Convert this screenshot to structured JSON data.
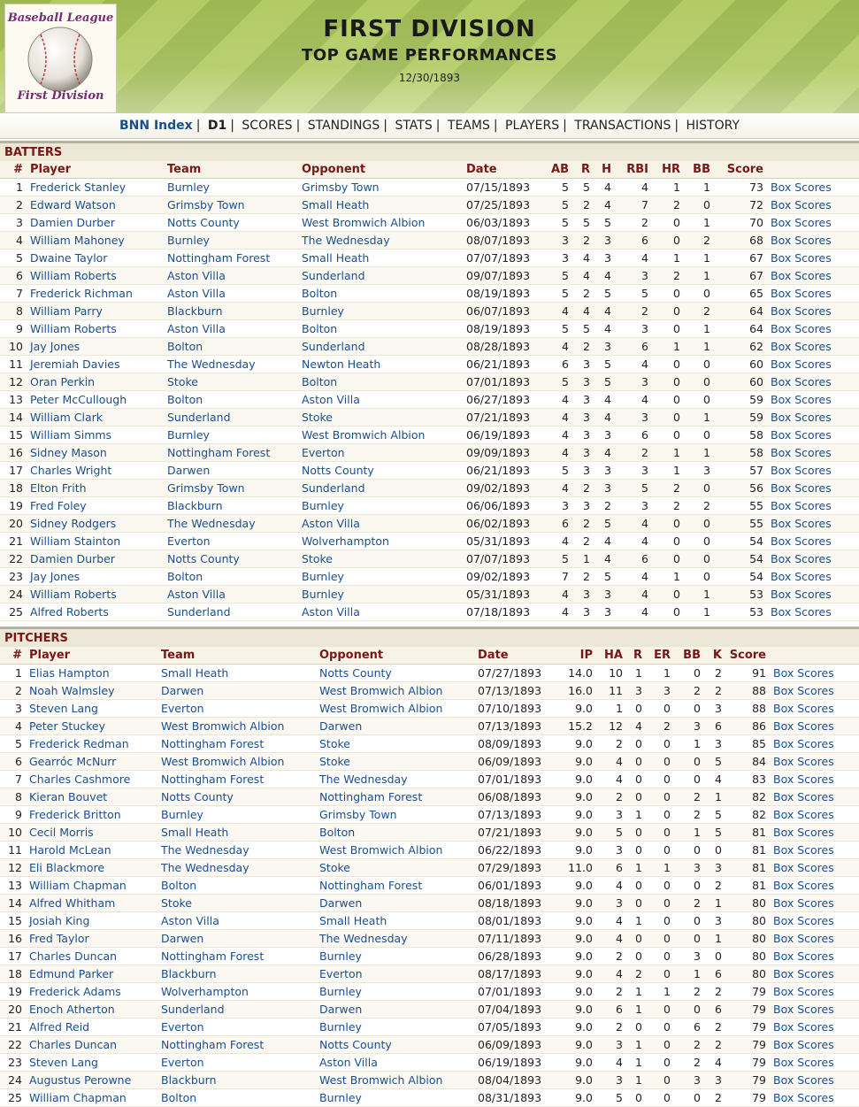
{
  "header": {
    "logo_top": "Baseball League",
    "logo_bottom": "First Division",
    "title": "FIRST DIVISION",
    "subtitle": "TOP GAME PERFORMANCES",
    "date": "12/30/1893"
  },
  "nav": [
    "BNN Index",
    "D1",
    "SCORES",
    "STANDINGS",
    "STATS",
    "TEAMS",
    "PLAYERS",
    "TRANSACTIONS",
    "HISTORY"
  ],
  "batters": {
    "title": "BATTERS",
    "columns": [
      "#",
      "Player",
      "Team",
      "Opponent",
      "Date",
      "AB",
      "R",
      "H",
      "RBI",
      "HR",
      "BB",
      "Score",
      ""
    ],
    "rows": [
      [
        "1",
        "Frederick Stanley",
        "Burnley",
        "Grimsby Town",
        "07/15/1893",
        "5",
        "5",
        "4",
        "4",
        "1",
        "1",
        "73",
        "Box Scores"
      ],
      [
        "2",
        "Edward Watson",
        "Grimsby Town",
        "Small Heath",
        "07/25/1893",
        "5",
        "2",
        "4",
        "7",
        "2",
        "0",
        "72",
        "Box Scores"
      ],
      [
        "3",
        "Damien Durber",
        "Notts County",
        "West Bromwich Albion",
        "06/03/1893",
        "5",
        "5",
        "5",
        "2",
        "0",
        "1",
        "70",
        "Box Scores"
      ],
      [
        "4",
        "William Mahoney",
        "Burnley",
        "The Wednesday",
        "08/07/1893",
        "3",
        "2",
        "3",
        "6",
        "0",
        "2",
        "68",
        "Box Scores"
      ],
      [
        "5",
        "Dwaine Taylor",
        "Nottingham Forest",
        "Small Heath",
        "07/07/1893",
        "3",
        "4",
        "3",
        "4",
        "1",
        "1",
        "67",
        "Box Scores"
      ],
      [
        "6",
        "William Roberts",
        "Aston Villa",
        "Sunderland",
        "09/07/1893",
        "5",
        "4",
        "4",
        "3",
        "2",
        "1",
        "67",
        "Box Scores"
      ],
      [
        "7",
        "Frederick Richman",
        "Aston Villa",
        "Bolton",
        "08/19/1893",
        "5",
        "2",
        "5",
        "5",
        "0",
        "0",
        "65",
        "Box Scores"
      ],
      [
        "8",
        "William Parry",
        "Blackburn",
        "Burnley",
        "06/07/1893",
        "4",
        "4",
        "4",
        "2",
        "0",
        "2",
        "64",
        "Box Scores"
      ],
      [
        "9",
        "William Roberts",
        "Aston Villa",
        "Bolton",
        "08/19/1893",
        "5",
        "5",
        "4",
        "3",
        "0",
        "1",
        "64",
        "Box Scores"
      ],
      [
        "10",
        "Jay Jones",
        "Bolton",
        "Sunderland",
        "08/28/1893",
        "4",
        "2",
        "3",
        "6",
        "1",
        "1",
        "62",
        "Box Scores"
      ],
      [
        "11",
        "Jeremiah Davies",
        "The Wednesday",
        "Newton Heath",
        "06/21/1893",
        "6",
        "3",
        "5",
        "4",
        "0",
        "0",
        "60",
        "Box Scores"
      ],
      [
        "12",
        "Oran Perkin",
        "Stoke",
        "Bolton",
        "07/01/1893",
        "5",
        "3",
        "5",
        "3",
        "0",
        "0",
        "60",
        "Box Scores"
      ],
      [
        "13",
        "Peter McCullough",
        "Bolton",
        "Aston Villa",
        "06/27/1893",
        "4",
        "3",
        "4",
        "4",
        "0",
        "0",
        "59",
        "Box Scores"
      ],
      [
        "14",
        "William Clark",
        "Sunderland",
        "Stoke",
        "07/21/1893",
        "4",
        "3",
        "4",
        "3",
        "0",
        "1",
        "59",
        "Box Scores"
      ],
      [
        "15",
        "William Simms",
        "Burnley",
        "West Bromwich Albion",
        "06/19/1893",
        "4",
        "3",
        "3",
        "6",
        "0",
        "0",
        "58",
        "Box Scores"
      ],
      [
        "16",
        "Sidney Mason",
        "Nottingham Forest",
        "Everton",
        "09/09/1893",
        "4",
        "3",
        "4",
        "2",
        "1",
        "1",
        "58",
        "Box Scores"
      ],
      [
        "17",
        "Charles Wright",
        "Darwen",
        "Notts County",
        "06/21/1893",
        "5",
        "3",
        "3",
        "3",
        "1",
        "3",
        "57",
        "Box Scores"
      ],
      [
        "18",
        "Elton Frith",
        "Grimsby Town",
        "Sunderland",
        "09/02/1893",
        "4",
        "2",
        "3",
        "5",
        "2",
        "0",
        "56",
        "Box Scores"
      ],
      [
        "19",
        "Fred Foley",
        "Blackburn",
        "Burnley",
        "06/06/1893",
        "3",
        "3",
        "2",
        "3",
        "2",
        "2",
        "55",
        "Box Scores"
      ],
      [
        "20",
        "Sidney Rodgers",
        "The Wednesday",
        "Aston Villa",
        "06/02/1893",
        "6",
        "2",
        "5",
        "4",
        "0",
        "0",
        "55",
        "Box Scores"
      ],
      [
        "21",
        "William Stainton",
        "Everton",
        "Wolverhampton",
        "05/31/1893",
        "4",
        "2",
        "4",
        "4",
        "0",
        "0",
        "54",
        "Box Scores"
      ],
      [
        "22",
        "Damien Durber",
        "Notts County",
        "Stoke",
        "07/07/1893",
        "5",
        "1",
        "4",
        "6",
        "0",
        "0",
        "54",
        "Box Scores"
      ],
      [
        "23",
        "Jay Jones",
        "Bolton",
        "Burnley",
        "09/02/1893",
        "7",
        "2",
        "5",
        "4",
        "1",
        "0",
        "54",
        "Box Scores"
      ],
      [
        "24",
        "William Roberts",
        "Aston Villa",
        "Burnley",
        "05/31/1893",
        "4",
        "3",
        "3",
        "4",
        "0",
        "1",
        "53",
        "Box Scores"
      ],
      [
        "25",
        "Alfred Roberts",
        "Sunderland",
        "Aston Villa",
        "07/18/1893",
        "4",
        "3",
        "3",
        "4",
        "0",
        "1",
        "53",
        "Box Scores"
      ]
    ]
  },
  "pitchers": {
    "title": "PITCHERS",
    "columns": [
      "#",
      "Player",
      "Team",
      "Opponent",
      "Date",
      "IP",
      "HA",
      "R",
      "ER",
      "BB",
      "K",
      "Score",
      ""
    ],
    "rows": [
      [
        "1",
        "Elias Hampton",
        "Small Heath",
        "Notts County",
        "07/27/1893",
        "14.0",
        "10",
        "1",
        "1",
        "0",
        "2",
        "91",
        "Box Scores"
      ],
      [
        "2",
        "Noah Walmsley",
        "Darwen",
        "West Bromwich Albion",
        "07/13/1893",
        "16.0",
        "11",
        "3",
        "3",
        "2",
        "2",
        "88",
        "Box Scores"
      ],
      [
        "3",
        "Steven Lang",
        "Everton",
        "West Bromwich Albion",
        "07/10/1893",
        "9.0",
        "1",
        "0",
        "0",
        "0",
        "3",
        "88",
        "Box Scores"
      ],
      [
        "4",
        "Peter Stuckey",
        "West Bromwich Albion",
        "Darwen",
        "07/13/1893",
        "15.2",
        "12",
        "4",
        "2",
        "3",
        "6",
        "86",
        "Box Scores"
      ],
      [
        "5",
        "Frederick Redman",
        "Nottingham Forest",
        "Stoke",
        "08/09/1893",
        "9.0",
        "2",
        "0",
        "0",
        "1",
        "3",
        "85",
        "Box Scores"
      ],
      [
        "6",
        "Gearróc McNurr",
        "West Bromwich Albion",
        "Stoke",
        "06/09/1893",
        "9.0",
        "4",
        "0",
        "0",
        "0",
        "5",
        "84",
        "Box Scores"
      ],
      [
        "7",
        "Charles Cashmore",
        "Nottingham Forest",
        "The Wednesday",
        "07/01/1893",
        "9.0",
        "4",
        "0",
        "0",
        "0",
        "4",
        "83",
        "Box Scores"
      ],
      [
        "8",
        "Kieran Bouvet",
        "Notts County",
        "Nottingham Forest",
        "06/08/1893",
        "9.0",
        "2",
        "0",
        "0",
        "2",
        "1",
        "82",
        "Box Scores"
      ],
      [
        "9",
        "Frederick Britton",
        "Burnley",
        "Grimsby Town",
        "07/13/1893",
        "9.0",
        "3",
        "1",
        "0",
        "2",
        "5",
        "82",
        "Box Scores"
      ],
      [
        "10",
        "Cecil Morris",
        "Small Heath",
        "Bolton",
        "07/21/1893",
        "9.0",
        "5",
        "0",
        "0",
        "1",
        "5",
        "81",
        "Box Scores"
      ],
      [
        "11",
        "Harold McLean",
        "The Wednesday",
        "West Bromwich Albion",
        "06/22/1893",
        "9.0",
        "3",
        "0",
        "0",
        "0",
        "0",
        "81",
        "Box Scores"
      ],
      [
        "12",
        "Eli Blackmore",
        "The Wednesday",
        "Stoke",
        "07/29/1893",
        "11.0",
        "6",
        "1",
        "1",
        "3",
        "3",
        "81",
        "Box Scores"
      ],
      [
        "13",
        "William Chapman",
        "Bolton",
        "Nottingham Forest",
        "06/01/1893",
        "9.0",
        "4",
        "0",
        "0",
        "0",
        "2",
        "81",
        "Box Scores"
      ],
      [
        "14",
        "Alfred Whitham",
        "Stoke",
        "Darwen",
        "08/18/1893",
        "9.0",
        "3",
        "0",
        "0",
        "2",
        "1",
        "80",
        "Box Scores"
      ],
      [
        "15",
        "Josiah King",
        "Aston Villa",
        "Small Heath",
        "08/01/1893",
        "9.0",
        "4",
        "1",
        "0",
        "0",
        "3",
        "80",
        "Box Scores"
      ],
      [
        "16",
        "Fred Taylor",
        "Darwen",
        "The Wednesday",
        "07/11/1893",
        "9.0",
        "4",
        "0",
        "0",
        "0",
        "1",
        "80",
        "Box Scores"
      ],
      [
        "17",
        "Charles Duncan",
        "Nottingham Forest",
        "Burnley",
        "06/28/1893",
        "9.0",
        "2",
        "0",
        "0",
        "3",
        "0",
        "80",
        "Box Scores"
      ],
      [
        "18",
        "Edmund Parker",
        "Blackburn",
        "Everton",
        "08/17/1893",
        "9.0",
        "4",
        "2",
        "0",
        "1",
        "6",
        "80",
        "Box Scores"
      ],
      [
        "19",
        "Frederick Adams",
        "Wolverhampton",
        "Burnley",
        "07/01/1893",
        "9.0",
        "2",
        "1",
        "1",
        "2",
        "2",
        "79",
        "Box Scores"
      ],
      [
        "20",
        "Enoch Atherton",
        "Sunderland",
        "Darwen",
        "07/04/1893",
        "9.0",
        "6",
        "1",
        "0",
        "0",
        "6",
        "79",
        "Box Scores"
      ],
      [
        "21",
        "Alfred Reid",
        "Everton",
        "Burnley",
        "07/05/1893",
        "9.0",
        "2",
        "0",
        "0",
        "6",
        "2",
        "79",
        "Box Scores"
      ],
      [
        "22",
        "Charles Duncan",
        "Nottingham Forest",
        "Notts County",
        "06/09/1893",
        "9.0",
        "3",
        "1",
        "0",
        "2",
        "2",
        "79",
        "Box Scores"
      ],
      [
        "23",
        "Steven Lang",
        "Everton",
        "Aston Villa",
        "06/19/1893",
        "9.0",
        "4",
        "1",
        "0",
        "2",
        "4",
        "79",
        "Box Scores"
      ],
      [
        "24",
        "Augustus Perowne",
        "Blackburn",
        "West Bromwich Albion",
        "08/04/1893",
        "9.0",
        "3",
        "1",
        "0",
        "3",
        "3",
        "79",
        "Box Scores"
      ],
      [
        "25",
        "William Chapman",
        "Bolton",
        "Burnley",
        "08/31/1893",
        "9.0",
        "5",
        "0",
        "0",
        "0",
        "2",
        "79",
        "Box Scores"
      ]
    ]
  }
}
